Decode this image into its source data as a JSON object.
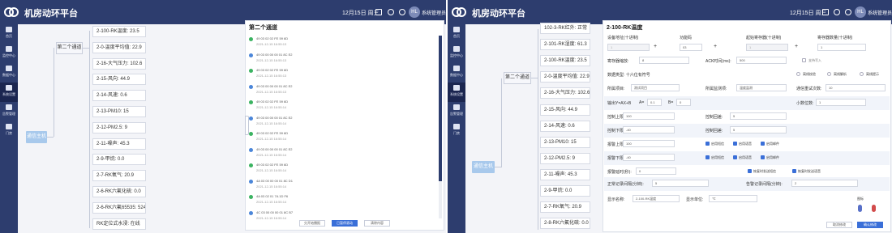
{
  "app": {
    "title": "机房动环平台",
    "date": "12月15日 周三",
    "user": "系统管理员",
    "avatar": "HL"
  },
  "sidebar": {
    "items": [
      "首页",
      "监控中心",
      "数据中心",
      "系统设置",
      "告警管理",
      "门禁"
    ]
  },
  "host_button": "通信主机",
  "channel_button": "第二个通道",
  "screen1": {
    "points": [
      "2-100-RK温度: 23.5",
      "2-0-温度平均值: 22.9",
      "2-16-大气压力: 102.6",
      "2-15-风向: 44.9",
      "2-14-风速: 0.6",
      "2-13-PM10: 15",
      "2-12-PM2.5: 9",
      "2-11-噪声: 45.3",
      "2-9-甲烷: 0.0",
      "2-7-RK氧气: 20.9",
      "2-6-RK六氟化硫: 0.0",
      "2-6-RK六氟65535: 524",
      "RK定位式水浸: 在线"
    ],
    "panel_title": "第二个通道",
    "logs": [
      {
        "hex": "49 03 02 02 FE 59 6D",
        "time": "2021-12-15 16:55:13"
      },
      {
        "hex": "49 03 00 00 00 01 8C E2",
        "time": "2021-12-15 16:55:13"
      },
      {
        "hex": "49 03 02 02 FE 59 6D",
        "time": "2021-12-15 16:55:13"
      },
      {
        "hex": "49 03 00 00 00 01 8C E2",
        "time": "2021-12-15 16:55:13"
      },
      {
        "hex": "49 03 02 02 FE 59 6D",
        "time": "2021-12-15 16:55:14"
      },
      {
        "hex": "49 03 00 00 00 01 8C E2",
        "time": "2021-12-15 16:55:14"
      },
      {
        "hex": "49 03 02 02 FE 59 6D",
        "time": "2021-12-15 16:55:14"
      },
      {
        "hex": "49 03 00 00 00 01 8C E2",
        "time": "2021-12-15 16:55:14"
      },
      {
        "hex": "49 03 02 02 FE 59 6D",
        "time": "2021-12-15 16:55:14"
      },
      {
        "hex": "4A 03 00 00 00 01 8C D1",
        "time": "2021-12-15 16:55:14"
      },
      {
        "hex": "4A 03 02 01 7A 1D F6",
        "time": "2021-12-15 16:55:14"
      },
      {
        "hex": "4C 03 00 00 00 01 8C B7",
        "time": "2021-12-15 16:55:14"
      }
    ],
    "buttons": {
      "pause": "分开始播报",
      "scroll": "已暂停滚动",
      "clear": "清除内容"
    }
  },
  "screen2": {
    "points": [
      "102-3-RK红外: 正常",
      "2-101-RK湿度: 61.3",
      "2-100-RK温度: 23.5",
      "2-0-温度平均值: 22.9",
      "2-16-大气压力: 102.6",
      "2-15-风向: 44.9",
      "2-14-风速: 0.6",
      "2-13-PM10: 15",
      "2-12-PM2.5: 9",
      "2-11-噪声: 45.3",
      "2-9-甲烷: 0.0",
      "2-7-RK氧气: 20.9",
      "2-8-RK六氟化硫: 0.0"
    ],
    "form": {
      "title": "2-100-RK温度",
      "addr_label": "设备地址(十进制)",
      "addr_value": "1",
      "func_label": "功能码",
      "func_value": "03",
      "start_label": "起始寄存器(十进制)",
      "start_value": "1",
      "count_label": "寄存器数量(十进制)",
      "count_value": "1",
      "scale_label": "寄存器缩放:",
      "scale_value": "8",
      "ack_label": "ACK时间(ms):",
      "ack_value": "500",
      "support_label": "支持写入",
      "dtype_label": "数据类型: 十六位有符号",
      "radios": [
        "离线校验",
        "离线解析",
        "离线提示"
      ],
      "proj_label": "所属项目:",
      "proj_value": "测试项目",
      "mon_label": "所属监测项:",
      "mon_value": "温度监测",
      "retry_label": "通信重试次数:",
      "retry_value": "10",
      "formula_label": "输出Y=AX+B",
      "a_label": "A=",
      "a_value": "0.1",
      "b_label": "B=",
      "b_value": "0",
      "dec_label": "小数位数:",
      "dec_value": "1",
      "ctl_upper": "控制上限:",
      "ctl_upper_val": "100",
      "ctl_lower": "控制下限:",
      "ctl_lower_val": "-40",
      "ctl_return1": "控制回差:",
      "ctl_return1_val": "5",
      "ctl_return2": "控制回差:",
      "ctl_return2_val": "5",
      "alarm_upper": "报警上限:",
      "alarm_upper_val": "100",
      "alarm_lower": "报警下限:",
      "alarm_lower_val": "-40",
      "checks_upper": [
        "启用短信",
        "启用语音",
        "启用邮件"
      ],
      "checks_lower": [
        "启用短信",
        "启用语音",
        "启用邮件"
      ],
      "delay_label": "报警延时(秒):",
      "delay_value": "0",
      "resume_sms": "恢复时发送短信",
      "resume_voice": "恢复时发送语音",
      "normal_interval_label": "正常记录间隔(分钟):",
      "normal_interval_value": "5",
      "alarm_interval_label": "告警记录间隔(分钟):",
      "alarm_interval_value": "2",
      "display_name_label": "显示名称:",
      "display_name_value": "2-100-RK温度",
      "unit_label": "显示单位:",
      "unit_value": "℃",
      "icon_label": "图标",
      "cancel": "取消修改",
      "confirm": "确认修改"
    }
  }
}
